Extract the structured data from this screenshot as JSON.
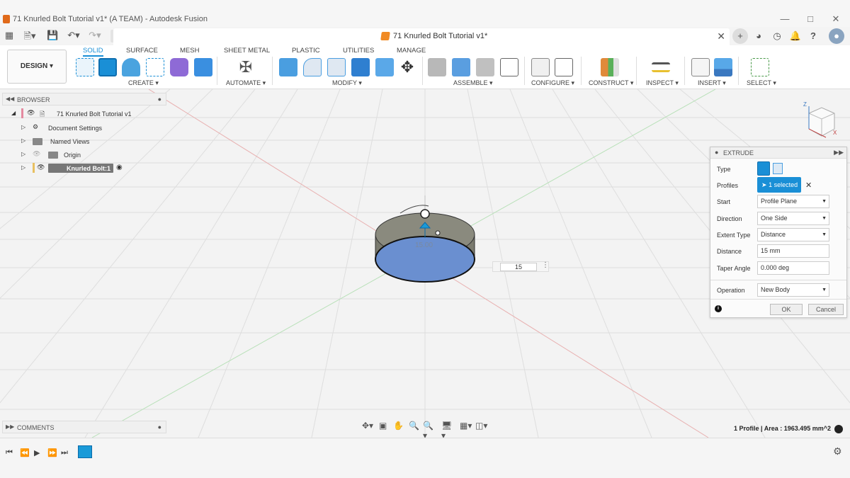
{
  "window": {
    "title": "71 Knurled Bolt Tutorial v1* (A TEAM) - Autodesk Fusion",
    "controls": [
      "—",
      "□",
      "✕"
    ]
  },
  "doc_tab": {
    "label": "71 Knurled Bolt Tutorial v1*",
    "close": "✕"
  },
  "ribbon": {
    "design_label": "DESIGN",
    "tabs": [
      "SOLID",
      "SURFACE",
      "MESH",
      "SHEET METAL",
      "PLASTIC",
      "UTILITIES",
      "MANAGE"
    ],
    "active_tab": "SOLID",
    "groups": [
      "CREATE",
      "AUTOMATE",
      "MODIFY",
      "ASSEMBLE",
      "CONFIGURE",
      "CONSTRUCT",
      "INSPECT",
      "INSERT",
      "SELECT"
    ]
  },
  "browser": {
    "header": "BROWSER",
    "items": [
      {
        "label": "71 Knurled Bolt Tutorial v1"
      },
      {
        "label": "Document Settings"
      },
      {
        "label": "Named Views"
      },
      {
        "label": "Origin"
      },
      {
        "label": "Knurled Bolt:1"
      }
    ]
  },
  "comments": {
    "label": "COMMENTS"
  },
  "viewport": {
    "dimension_label": "15.00",
    "distance_input": "15",
    "status": "1 Profile | Area : 1963.495 mm^2"
  },
  "extrude": {
    "title": "EXTRUDE",
    "rows": [
      {
        "label": "Type"
      },
      {
        "label": "Profiles",
        "value": "1 selected"
      },
      {
        "label": "Start",
        "value": "Profile Plane"
      },
      {
        "label": "Direction",
        "value": "One Side"
      },
      {
        "label": "Extent Type",
        "value": "Distance"
      },
      {
        "label": "Distance",
        "value": "15 mm"
      },
      {
        "label": "Taper Angle",
        "value": "0.000 deg"
      },
      {
        "label": "Operation",
        "value": "New Body"
      }
    ],
    "ok": "OK",
    "cancel": "Cancel"
  },
  "colors": {
    "accent": "#1a8fd6",
    "body_blue": "#6a8fd0",
    "body_side": "#7a7a6e",
    "selected_bg": "#1a8fd6"
  }
}
